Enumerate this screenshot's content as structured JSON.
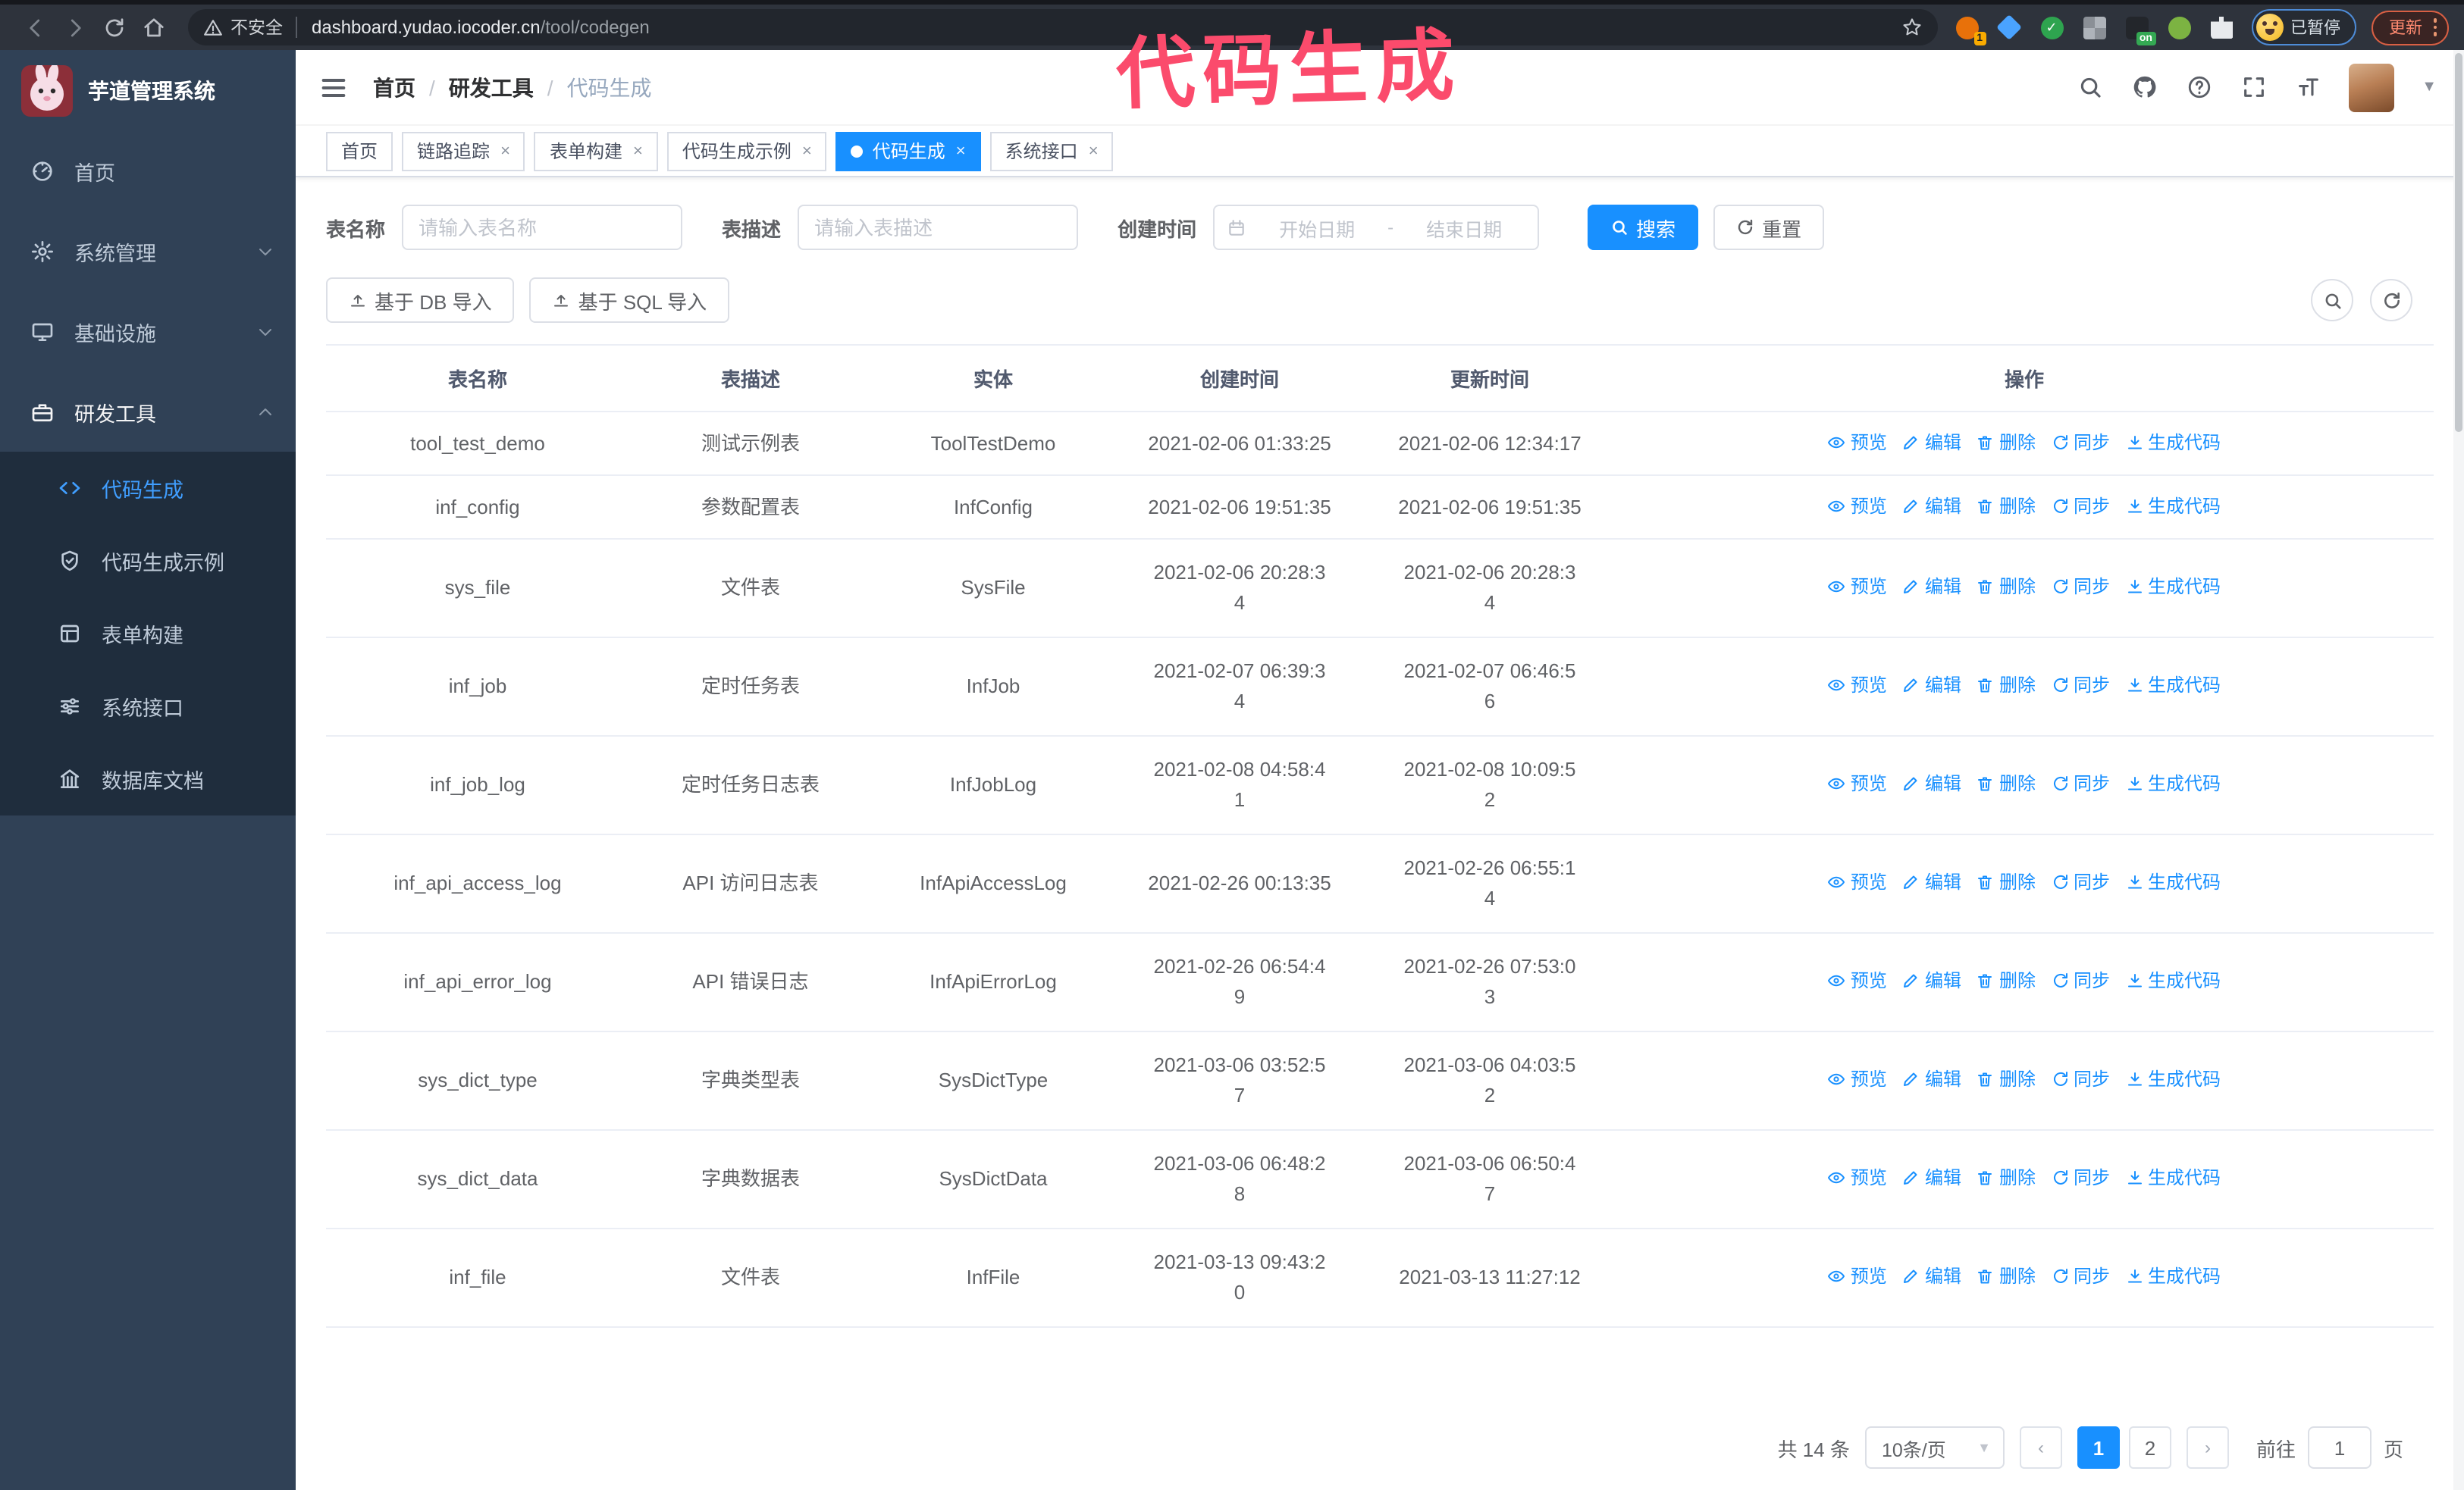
{
  "browser": {
    "security_label": "不安全",
    "url_domain": "dashboard.yudao.iocoder.cn",
    "url_path": "/tool/codegen",
    "profile_badge": "已暂停",
    "update_label": "更新",
    "extensions": [
      {
        "name": "extension-icon-1",
        "shape": "circle",
        "color": "#e8710a",
        "badge": "1",
        "badge_bg": "#f9ab00",
        "badge_fg": "#202124"
      },
      {
        "name": "extension-icon-2",
        "shape": "diamond",
        "color": "#4aa3ff"
      },
      {
        "name": "extension-icon-3",
        "shape": "circle",
        "color": "#2ea44f",
        "check": true
      },
      {
        "name": "extension-icon-4",
        "shape": "grid",
        "color": "#aeb3ba"
      },
      {
        "name": "extension-icon-5",
        "shape": "square",
        "color": "#23262b",
        "badge": "on",
        "badge_bg": "#34a853",
        "badge_fg": "#ffffff"
      },
      {
        "name": "extension-icon-6",
        "shape": "circle",
        "color": "#7cb342"
      },
      {
        "name": "extension-icon-7",
        "shape": "puzzle",
        "color": "#e8eaed"
      }
    ]
  },
  "annotation": {
    "text": "代码生成",
    "color": "#fb4b6c"
  },
  "sidebar": {
    "title": "芋道管理系统",
    "items": [
      {
        "label": "首页",
        "icon": "dashboard-icon"
      },
      {
        "label": "系统管理",
        "icon": "gear-icon",
        "chevron": "down"
      },
      {
        "label": "基础设施",
        "icon": "monitor-icon",
        "chevron": "down"
      },
      {
        "label": "研发工具",
        "icon": "briefcase-icon",
        "chevron": "up",
        "expanded": true
      }
    ],
    "submenu": [
      {
        "label": "代码生成",
        "icon": "code-icon",
        "active": true
      },
      {
        "label": "代码生成示例",
        "icon": "shield-icon"
      },
      {
        "label": "表单构建",
        "icon": "form-icon"
      },
      {
        "label": "系统接口",
        "icon": "sliders-icon"
      },
      {
        "label": "数据库文档",
        "icon": "database-icon"
      }
    ]
  },
  "breadcrumb": [
    "首页",
    "研发工具",
    "代码生成"
  ],
  "tabs": [
    {
      "label": "首页",
      "closable": false,
      "active": false
    },
    {
      "label": "链路追踪",
      "closable": true,
      "active": false
    },
    {
      "label": "表单构建",
      "closable": true,
      "active": false
    },
    {
      "label": "代码生成示例",
      "closable": true,
      "active": false
    },
    {
      "label": "代码生成",
      "closable": true,
      "active": true
    },
    {
      "label": "系统接口",
      "closable": true,
      "active": false
    }
  ],
  "search_form": {
    "fields": [
      {
        "label": "表名称",
        "placeholder": "请输入表名称"
      },
      {
        "label": "表描述",
        "placeholder": "请输入表描述"
      },
      {
        "label": "创建时间",
        "start_placeholder": "开始日期",
        "separator": "-",
        "end_placeholder": "结束日期"
      }
    ],
    "search_label": "搜索",
    "reset_label": "重置"
  },
  "import_buttons": [
    {
      "label": "基于 DB 导入",
      "icon": "upload-icon"
    },
    {
      "label": "基于 SQL 导入",
      "icon": "upload-icon"
    }
  ],
  "table": {
    "columns": [
      "表名称",
      "表描述",
      "实体",
      "创建时间",
      "更新时间",
      "操作"
    ],
    "actions": [
      {
        "label": "预览",
        "icon": "eye-icon"
      },
      {
        "label": "编辑",
        "icon": "edit-icon"
      },
      {
        "label": "删除",
        "icon": "delete-icon"
      },
      {
        "label": "同步",
        "icon": "sync-icon"
      },
      {
        "label": "生成代码",
        "icon": "download-icon"
      }
    ],
    "rows": [
      {
        "name": "tool_test_demo",
        "desc": "测试示例表",
        "entity": "ToolTestDemo",
        "created": "2021-02-06 01:33:25",
        "updated": "2021-02-06 12:34:17"
      },
      {
        "name": "inf_config",
        "desc": "参数配置表",
        "entity": "InfConfig",
        "created": "2021-02-06 19:51:35",
        "updated": "2021-02-06 19:51:35"
      },
      {
        "name": "sys_file",
        "desc": "文件表",
        "entity": "SysFile",
        "created": "2021-02-06 20:28:3\n4",
        "updated": "2021-02-06 20:28:3\n4"
      },
      {
        "name": "inf_job",
        "desc": "定时任务表",
        "entity": "InfJob",
        "created": "2021-02-07 06:39:3\n4",
        "updated": "2021-02-07 06:46:5\n6"
      },
      {
        "name": "inf_job_log",
        "desc": "定时任务日志表",
        "entity": "InfJobLog",
        "created": "2021-02-08 04:58:4\n1",
        "updated": "2021-02-08 10:09:5\n2"
      },
      {
        "name": "inf_api_access_log",
        "desc": "API 访问日志表",
        "entity": "InfApiAccessLog",
        "created": "2021-02-26 00:13:35",
        "updated": "2021-02-26 06:55:1\n4"
      },
      {
        "name": "inf_api_error_log",
        "desc": "API 错误日志",
        "entity": "InfApiErrorLog",
        "created": "2021-02-26 06:54:4\n9",
        "updated": "2021-02-26 07:53:0\n3"
      },
      {
        "name": "sys_dict_type",
        "desc": "字典类型表",
        "entity": "SysDictType",
        "created": "2021-03-06 03:52:5\n7",
        "updated": "2021-03-06 04:03:5\n2"
      },
      {
        "name": "sys_dict_data",
        "desc": "字典数据表",
        "entity": "SysDictData",
        "created": "2021-03-06 06:48:2\n8",
        "updated": "2021-03-06 06:50:4\n7"
      },
      {
        "name": "inf_file",
        "desc": "文件表",
        "entity": "InfFile",
        "created": "2021-03-13 09:43:2\n0",
        "updated": "2021-03-13 11:27:12"
      }
    ]
  },
  "pagination": {
    "total": "共 14 条",
    "page_size": "10条/页",
    "pages": [
      "1",
      "2"
    ],
    "active_page": "1",
    "goto_label": "前往",
    "goto_value": "1",
    "page_suffix": "页"
  },
  "colors": {
    "primary": "#1890ff",
    "sidebar_bg": "#304156",
    "submenu_bg": "#1f2d3d",
    "annotation": "#fb4b6c"
  }
}
